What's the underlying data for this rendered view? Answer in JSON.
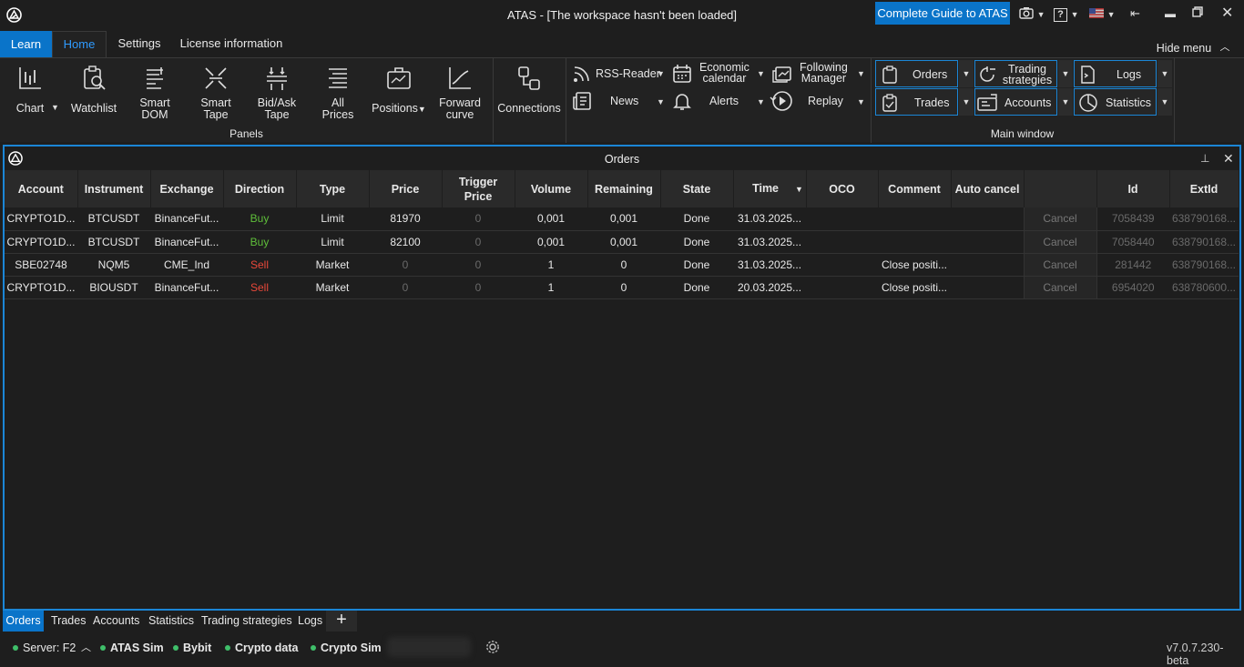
{
  "window": {
    "title": "ATAS - [The workspace hasn't been loaded]",
    "guide_button": "Complete Guide to ATAS"
  },
  "ribbon_tabs": [
    "Learn",
    "Home",
    "Settings",
    "License information"
  ],
  "hide_menu": "Hide menu",
  "panels": {
    "chart": "Chart",
    "watchlist": "Watchlist",
    "smart_dom": "Smart\nDOM",
    "smart_tape": "Smart\nTape",
    "bidask_tape": "Bid/Ask\nTape",
    "all_prices": "All\nPrices",
    "positions": "Positions",
    "forward_curve": "Forward\ncurve",
    "group_label": "Panels"
  },
  "connections": "Connections",
  "tools": {
    "rss": "RSS-Reader",
    "news": "News",
    "economic_calendar": "Economic\ncalendar",
    "alerts": "Alerts",
    "following_manager": "Following\nManager",
    "replay": "Replay"
  },
  "main_window": {
    "orders": "Orders",
    "trades": "Trades",
    "trading_strategies": "Trading\nstrategies",
    "accounts": "Accounts",
    "logs": "Logs",
    "statistics": "Statistics",
    "group_label": "Main window"
  },
  "orders_panel": {
    "title": "Orders",
    "columns": [
      "Account",
      "Instrument",
      "Exchange",
      "Direction",
      "Type",
      "Price",
      "Trigger\nPrice",
      "Volume",
      "Remaining",
      "State",
      "Time",
      "OCO",
      "Comment",
      "Auto cancel",
      "",
      "Id",
      "ExtId"
    ],
    "rows": [
      {
        "account": "CRYPTO1D...",
        "instrument": "BTCUSDT",
        "exchange": "BinanceFut...",
        "direction": "Buy",
        "type": "Limit",
        "price": "81970",
        "trigger_price": "0",
        "volume": "0,001",
        "remaining": "0,001",
        "state": "Done",
        "time": "31.03.2025...",
        "oco": "",
        "comment": "",
        "auto_cancel": "",
        "action": "Cancel",
        "id": "7058439",
        "extid": "638790168..."
      },
      {
        "account": "CRYPTO1D...",
        "instrument": "BTCUSDT",
        "exchange": "BinanceFut...",
        "direction": "Buy",
        "type": "Limit",
        "price": "82100",
        "trigger_price": "0",
        "volume": "0,001",
        "remaining": "0,001",
        "state": "Done",
        "time": "31.03.2025...",
        "oco": "",
        "comment": "",
        "auto_cancel": "",
        "action": "Cancel",
        "id": "7058440",
        "extid": "638790168..."
      },
      {
        "account": "SBE02748",
        "instrument": "NQM5",
        "exchange": "CME_Ind",
        "direction": "Sell",
        "type": "Market",
        "price": "0",
        "trigger_price": "0",
        "volume": "1",
        "remaining": "0",
        "state": "Done",
        "time": "31.03.2025...",
        "oco": "",
        "comment": "Close positi...",
        "auto_cancel": "",
        "action": "Cancel",
        "id": "281442",
        "extid": "638790168..."
      },
      {
        "account": "CRYPTO1D...",
        "instrument": "BIOUSDT",
        "exchange": "BinanceFut...",
        "direction": "Sell",
        "type": "Market",
        "price": "0",
        "trigger_price": "0",
        "volume": "1",
        "remaining": "0",
        "state": "Done",
        "time": "20.03.2025...",
        "oco": "",
        "comment": "Close positi...",
        "auto_cancel": "",
        "action": "Cancel",
        "id": "6954020",
        "extid": "638780600..."
      }
    ]
  },
  "bottom_tabs": [
    "Orders",
    "Trades",
    "Accounts",
    "Statistics",
    "Trading strategies",
    "Logs"
  ],
  "status": {
    "server": "Server: F2",
    "connections": [
      "ATAS Sim",
      "Bybit",
      "Crypto data",
      "Crypto Sim"
    ],
    "version": "v7.0.7.230-beta"
  },
  "colors": {
    "accent": "#0a74c9",
    "buy": "#5fbf3a",
    "sell": "#e8483a",
    "status_ok": "#3fbf6a"
  }
}
